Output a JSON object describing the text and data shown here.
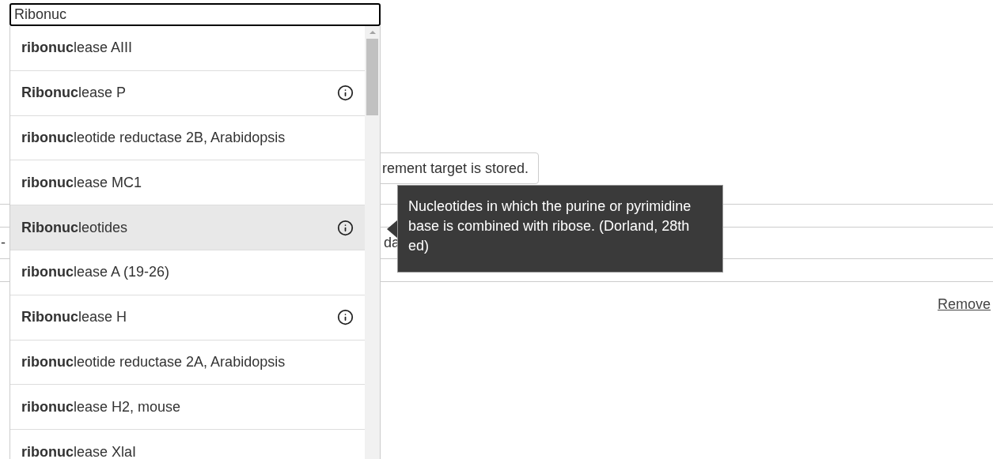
{
  "search": {
    "value": "Ribonuc"
  },
  "suggestions": [
    {
      "text": "**ribonuc**lease AIII",
      "info": false,
      "selected": false
    },
    {
      "text": "**Ribonuc**lease P",
      "info": true,
      "selected": false
    },
    {
      "text": "**ribonuc**leotide reductase 2B, Arabidopsis",
      "info": false,
      "selected": false
    },
    {
      "text": "**ribonuc**lease MC1",
      "info": false,
      "selected": false
    },
    {
      "text": "**Ribonuc**leotides",
      "info": true,
      "selected": true
    },
    {
      "text": "**ribonuc**lease A (19-26)",
      "info": false,
      "selected": false
    },
    {
      "text": "**Ribonuc**lease H",
      "info": true,
      "selected": false
    },
    {
      "text": "**ribonuc**leotide reductase 2A, Arabidopsis",
      "info": false,
      "selected": false
    },
    {
      "text": "**ribonuc**lease H2, mouse",
      "info": false,
      "selected": false
    },
    {
      "text": "**ribonuc**lease XlaI",
      "info": false,
      "selected": false
    }
  ],
  "tooltip": {
    "text": "Nucleotides in which the purine or pyrimidine base is combined with ribose. (Dorland, 28th ed)"
  },
  "page": {
    "notice": "rement target is stored.",
    "dash": "-",
    "fragment": "da",
    "remove_link": "Remove"
  }
}
